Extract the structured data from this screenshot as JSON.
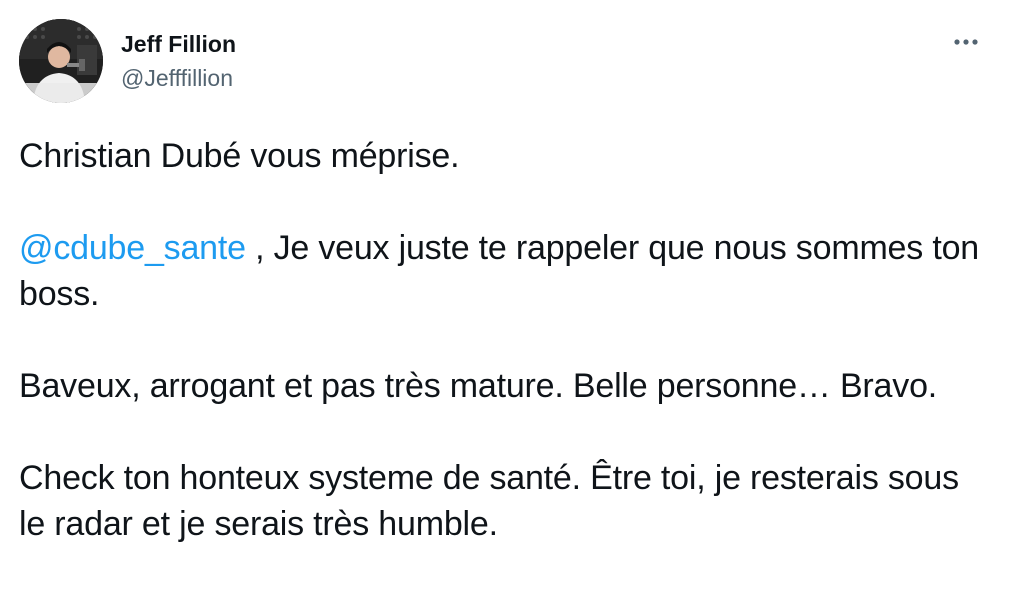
{
  "author": {
    "display_name": "Jeff Fillion",
    "handle": "@Jefffillion"
  },
  "icons": {
    "more": "more-horizontal-icon",
    "avatar": "profile-photo"
  },
  "colors": {
    "text": "#0f1419",
    "secondary": "#536471",
    "link": "#1d9bf0"
  },
  "tweet": {
    "para1": "Christian Dubé vous méprise.",
    "mention": "@cdube_sante",
    "para2_rest": " , Je veux juste te rappeler que nous sommes ton boss.",
    "para3": "Baveux, arrogant et pas très mature. Belle personne… Bravo.",
    "para4": "Check ton honteux systeme de santé. Être toi, je resterais sous le radar et je serais très humble."
  }
}
